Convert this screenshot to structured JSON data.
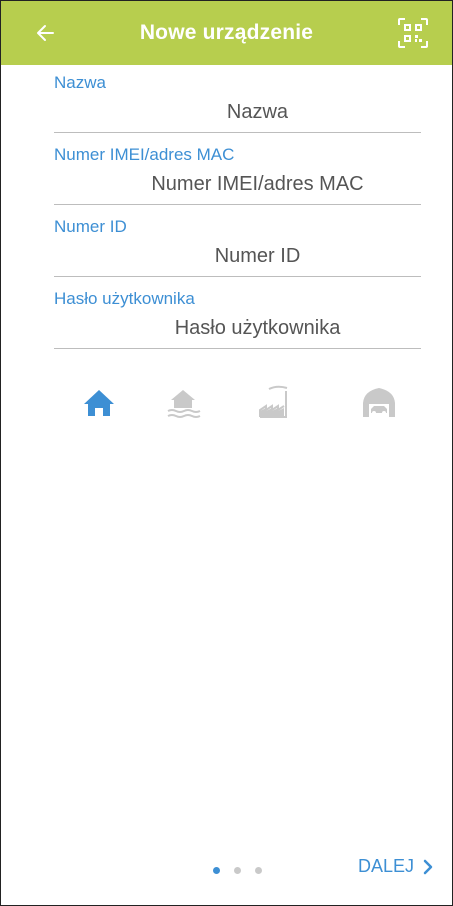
{
  "header": {
    "title": "Nowe urządzenie",
    "back_icon": "arrow-left-icon",
    "qr_icon": "qr-code-icon",
    "color": "#b7ce4e"
  },
  "fields": [
    {
      "label": "Nazwa",
      "placeholder": "Nazwa"
    },
    {
      "label": "Numer IMEI/adres MAC",
      "placeholder": "Numer IMEI/adres MAC"
    },
    {
      "label": "Numer ID",
      "placeholder": "Numer ID"
    },
    {
      "label": "Hasło użytkownika",
      "placeholder": "Hasło użytkownika"
    }
  ],
  "device_types": [
    {
      "icon": "house-icon",
      "selected": true
    },
    {
      "icon": "house-by-water-icon",
      "selected": false
    },
    {
      "icon": "factory-icon",
      "selected": false
    },
    {
      "icon": "garage-icon",
      "selected": false
    }
  ],
  "pagination": {
    "pages": 3,
    "current": 1
  },
  "footer": {
    "next_label": "DALEJ",
    "next_icon": "chevron-right-icon"
  },
  "colors": {
    "accent": "#3d8fd4",
    "inactive": "#c9c9c9"
  }
}
